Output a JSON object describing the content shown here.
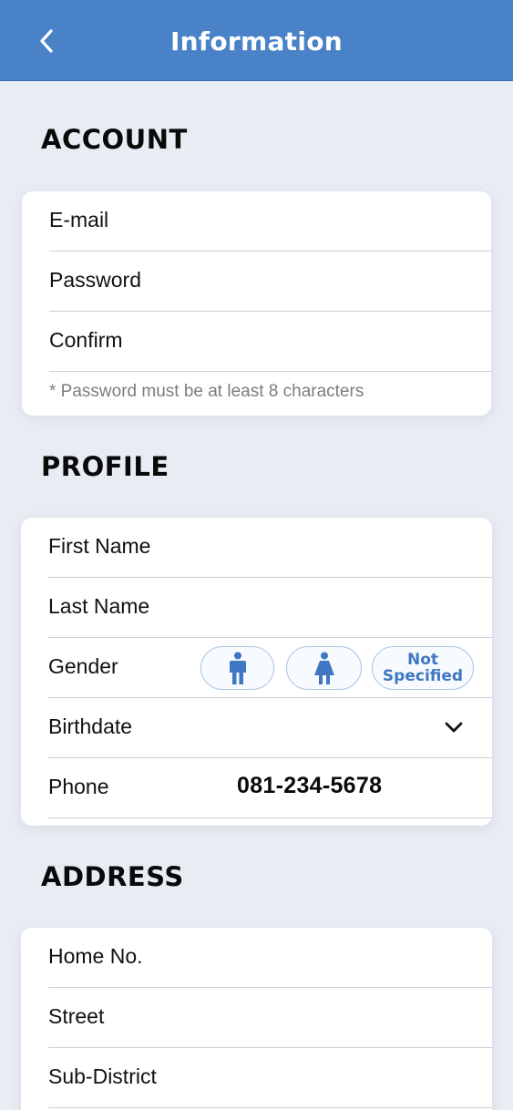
{
  "header": {
    "title": "Information",
    "back_icon": "chevron-left-icon"
  },
  "account": {
    "title": "ACCOUNT",
    "fields": [
      {
        "label": "E-mail"
      },
      {
        "label": "Password"
      },
      {
        "label": "Confirm"
      }
    ],
    "note": "* Password must be at least 8 characters"
  },
  "profile": {
    "title": "PROFILE",
    "first_name": "First Name",
    "last_name": "Last Name",
    "gender": {
      "label": "Gender",
      "options": [
        "male-icon",
        "female-icon",
        "Not Specified"
      ],
      "not_specified_line1": "Not",
      "not_specified_line2": "Specified"
    },
    "birthdate": {
      "label": "Birthdate",
      "icon": "chevron-down-icon"
    },
    "phone": {
      "label": "Phone",
      "value": "081-234-5678"
    }
  },
  "address": {
    "title": "ADDRESS",
    "fields": [
      {
        "label": "Home No."
      },
      {
        "label": "Street"
      },
      {
        "label": "Sub-District"
      }
    ]
  },
  "colors": {
    "header": "#4a82c8",
    "background": "#e8edf4",
    "accent": "#3f77c2"
  }
}
